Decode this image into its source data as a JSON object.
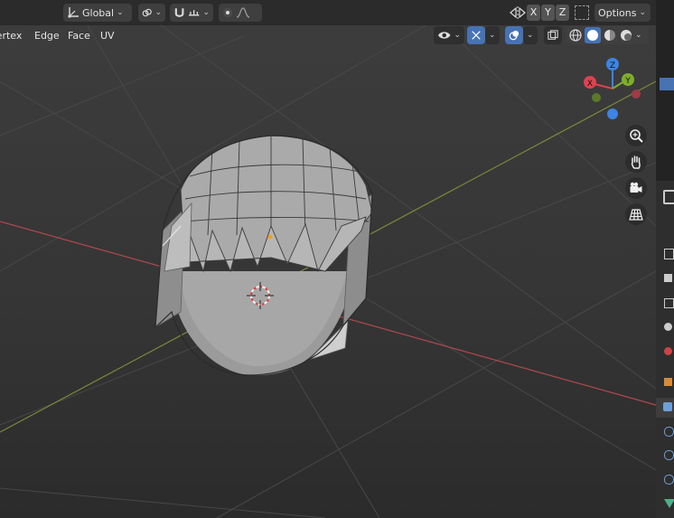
{
  "header": {
    "transform_orientation": "Global",
    "options_label": "Options",
    "axis_x": "X",
    "axis_y": "Y",
    "axis_z": "Z"
  },
  "menu": {
    "vertex": "Vertex",
    "edge": "Edge",
    "face": "Face",
    "uv": "UV"
  },
  "gizmo": {
    "x": "X",
    "y": "Y",
    "z": "Z"
  },
  "colors": {
    "x_axis": "#e0414f",
    "y_axis": "#7fae2b",
    "z_axis": "#3d84e4",
    "active_blue": "#4772b3"
  },
  "icons": [
    "transform-pivot-icon",
    "link-icon",
    "snap-magnet-icon",
    "snap-increment-icon",
    "proportional-edit-icon",
    "falloff-icon",
    "mirror-icon",
    "visibility-icon",
    "gizmo-icon",
    "overlay-icon",
    "xray-icon",
    "wireframe-shading-icon",
    "solid-shading-icon",
    "material-shading-icon",
    "rendered-shading-icon",
    "zoom-icon",
    "hand-pan-icon",
    "camera-icon",
    "grid-icon"
  ]
}
